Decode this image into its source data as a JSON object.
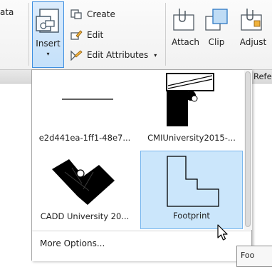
{
  "ribbon": {
    "data_fragment": "ata",
    "insert_label": "Insert",
    "insert_caret": "▾",
    "create_label": "Create",
    "edit_label": "Edit",
    "edit_attributes_label": "Edit Attributes",
    "edit_attributes_caret": "▾",
    "attach_label": "Attach",
    "clip_label": "Clip",
    "adjust_label": "Adjust",
    "reference_fragment": "Refe"
  },
  "gallery": {
    "items": [
      {
        "label": "e2d441ea-1ff1-48e7..."
      },
      {
        "label": "CMIUniversity2015-..."
      },
      {
        "label": "CADD University 20..."
      },
      {
        "label": "Footprint"
      }
    ],
    "more_options_label": "More Options..."
  },
  "tooltip": {
    "text": "Foo"
  },
  "colors": {
    "selection_fill": "#cbe6fb",
    "selection_border": "#78b6ee",
    "insert_button_border": "#3d8ee0"
  }
}
